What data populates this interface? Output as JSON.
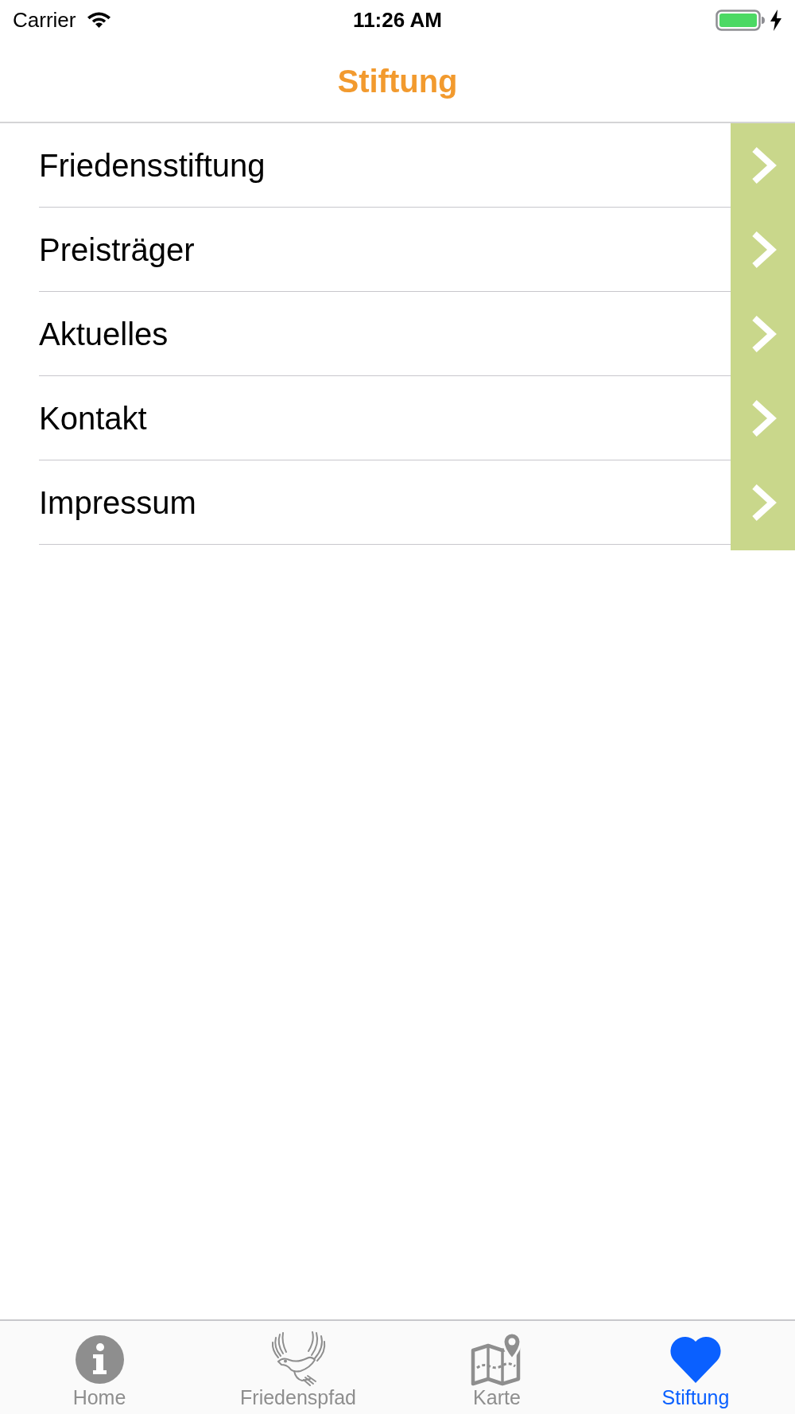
{
  "status_bar": {
    "carrier": "Carrier",
    "time": "11:26 AM"
  },
  "nav_bar": {
    "title": "Stiftung"
  },
  "menu": {
    "items": [
      {
        "label": "Friedensstiftung"
      },
      {
        "label": "Preisträger"
      },
      {
        "label": "Aktuelles"
      },
      {
        "label": "Kontakt"
      },
      {
        "label": "Impressum"
      }
    ]
  },
  "tab_bar": {
    "tabs": [
      {
        "label": "Home",
        "kind": "info",
        "selected": false
      },
      {
        "label": "Friedenspfad",
        "kind": "dove",
        "selected": false
      },
      {
        "label": "Karte",
        "kind": "map",
        "selected": false
      },
      {
        "label": "Stiftung",
        "kind": "heart",
        "selected": true
      }
    ]
  }
}
